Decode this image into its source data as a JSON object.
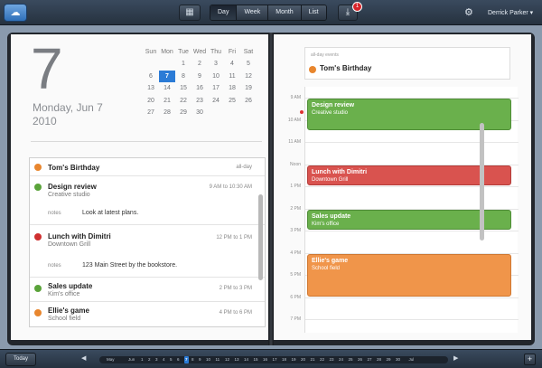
{
  "toolbar": {
    "view_tabs": [
      "Day",
      "Week",
      "Month",
      "List"
    ],
    "active_tab": "Day",
    "notification_count": "1",
    "user_name": "Derrick Parker ▾",
    "cloud_glyph": "☁",
    "download_glyph": "⤓",
    "gear_glyph": "⚙",
    "cal_glyph": "▦"
  },
  "left_page": {
    "day_number": "7",
    "day_name": "Monday, Jun 7",
    "year": "2010",
    "mini_calendar": {
      "weekdays": [
        "Sun",
        "Mon",
        "Tue",
        "Wed",
        "Thu",
        "Fri",
        "Sat"
      ],
      "weeks": [
        [
          "",
          "",
          "1",
          "2",
          "3",
          "4",
          "5"
        ],
        [
          "6",
          "7",
          "8",
          "9",
          "10",
          "11",
          "12"
        ],
        [
          "13",
          "14",
          "15",
          "16",
          "17",
          "18",
          "19"
        ],
        [
          "20",
          "21",
          "22",
          "23",
          "24",
          "25",
          "26"
        ],
        [
          "27",
          "28",
          "29",
          "30",
          "",
          "",
          ""
        ]
      ],
      "selected": "7"
    },
    "events": [
      {
        "title": "Tom's Birthday",
        "time": "all-day",
        "color": "#e8862e"
      },
      {
        "title": "Design review",
        "subtitle": "Creative studio",
        "time": "9 AM to 10:30 AM",
        "color": "#5aa33a",
        "notes_label": "notes",
        "notes": "Look at latest plans."
      },
      {
        "title": "Lunch with Dimitri",
        "subtitle": "Downtown Grill",
        "time": "12 PM to 1 PM",
        "color": "#cf2f2f",
        "notes_label": "notes",
        "notes": "123 Main Street by the bookstore."
      },
      {
        "title": "Sales update",
        "subtitle": "Kim's office",
        "time": "2 PM to 3 PM",
        "color": "#5aa33a"
      },
      {
        "title": "Ellie's game",
        "subtitle": "School field",
        "time": "4 PM to 6 PM",
        "color": "#e8862e"
      }
    ]
  },
  "right_page": {
    "all_day_label": "all-day events",
    "all_day_event": "Tom's Birthday",
    "hours": [
      "9 AM",
      "10 AM",
      "11 AM",
      "Noon",
      "1 PM",
      "2 PM",
      "3 PM",
      "4 PM",
      "5 PM",
      "6 PM",
      "7 PM"
    ],
    "events": [
      {
        "title": "Design review",
        "subtitle": "Creative studio",
        "color": "#6ab04c",
        "border": "#4f8d37",
        "start": 9,
        "end": 10.5
      },
      {
        "title": "Lunch with Dimitri",
        "subtitle": "Downtown Grill",
        "color": "#d9534f",
        "border": "#b33c39",
        "start": 12,
        "end": 13
      },
      {
        "title": "Sales update",
        "subtitle": "Kim's office",
        "color": "#6ab04c",
        "border": "#4f8d37",
        "start": 14,
        "end": 15
      },
      {
        "title": "Ellie's game",
        "subtitle": "School field",
        "color": "#f0954a",
        "border": "#cf7730",
        "start": 16,
        "end": 18
      }
    ]
  },
  "bottom_bar": {
    "today_label": "Today",
    "months": [
      "May",
      "Jun",
      "Jul"
    ],
    "days": [
      "1",
      "2",
      "3",
      "4",
      "5",
      "6",
      "7",
      "8",
      "9",
      "10",
      "11",
      "12",
      "13",
      "14",
      "15",
      "16",
      "17",
      "18",
      "19",
      "20",
      "21",
      "22",
      "23",
      "24",
      "25",
      "26",
      "27",
      "28",
      "29",
      "30"
    ],
    "current_day": "7",
    "add_glyph": "+",
    "left_arrow": "◀",
    "right_arrow": "▶"
  }
}
